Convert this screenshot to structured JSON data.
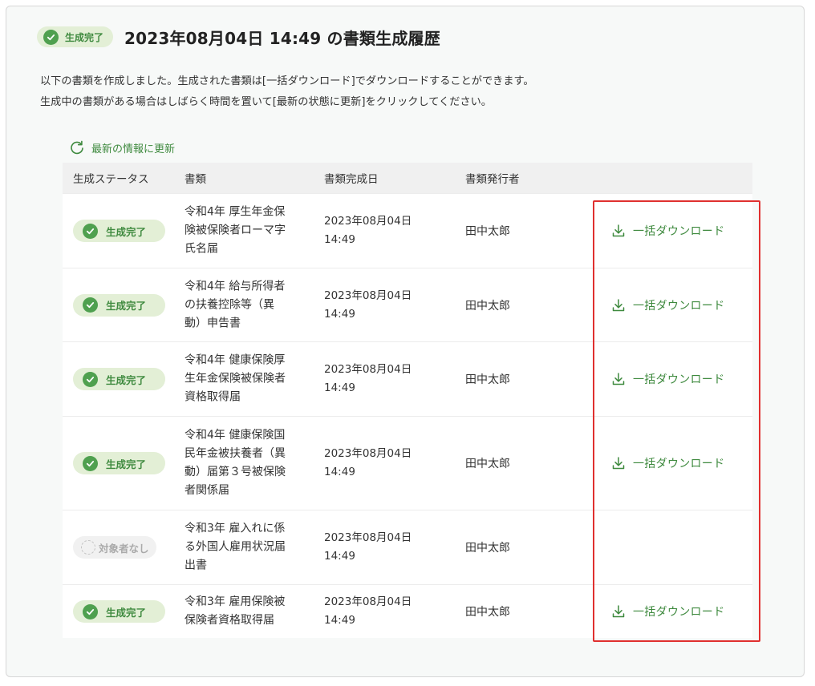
{
  "header": {
    "status_badge": "生成完了",
    "title": "2023年08月04日 14:49 の書類生成履歴"
  },
  "description": {
    "line1": "以下の書類を作成しました。生成された書類は[一括ダウンロード]でダウンロードすることができます。",
    "line2": "生成中の書類がある場合はしばらく時間を置いて[最新の状態に更新]をクリックしてください。"
  },
  "refresh": {
    "label": "最新の情報に更新",
    "icon": "refresh-icon"
  },
  "table": {
    "columns": [
      "生成ステータス",
      "書類",
      "書類完成日",
      "書類発行者",
      ""
    ],
    "rows": [
      {
        "status": "生成完了",
        "doc_lines": [
          "令和4年 厚生年金保",
          "険被保険者ローマ字",
          "氏名届"
        ],
        "date": "2023年08月04日",
        "time": "14:49",
        "issuer": "田中太郎",
        "download": "一括ダウンロード"
      },
      {
        "status": "生成完了",
        "doc_lines": [
          "令和4年 給与所得者",
          "の扶養控除等（異",
          "動）申告書"
        ],
        "date": "2023年08月04日",
        "time": "14:49",
        "issuer": "田中太郎",
        "download": "一括ダウンロード"
      },
      {
        "status": "生成完了",
        "doc_lines": [
          "令和4年 健康保険厚",
          "生年金保険被保険者",
          "資格取得届"
        ],
        "date": "2023年08月04日",
        "time": "14:49",
        "issuer": "田中太郎",
        "download": "一括ダウンロード"
      },
      {
        "status": "生成完了",
        "doc_lines": [
          "令和4年 健康保険国",
          "民年金被扶養者（異",
          "動）届第３号被保険",
          "者関係届"
        ],
        "date": "2023年08月04日",
        "time": "14:49",
        "issuer": "田中太郎",
        "download": "一括ダウンロード"
      },
      {
        "status": "対象者なし",
        "doc_lines": [
          "令和3年 雇入れに係",
          "る外国人雇用状況届",
          "出書"
        ],
        "date": "2023年08月04日",
        "time": "14:49",
        "issuer": "田中太郎",
        "download": null
      },
      {
        "status": "生成完了",
        "doc_lines": [
          "令和3年 雇用保険被",
          "保険者資格取得届"
        ],
        "date": "2023年08月04日",
        "time": "14:49",
        "issuer": "田中太郎",
        "download": "一括ダウンロード"
      }
    ]
  },
  "colors": {
    "accent_green": "#3f8a3f",
    "badge_bg": "#e3efd6",
    "highlight_red": "#e0302f"
  }
}
